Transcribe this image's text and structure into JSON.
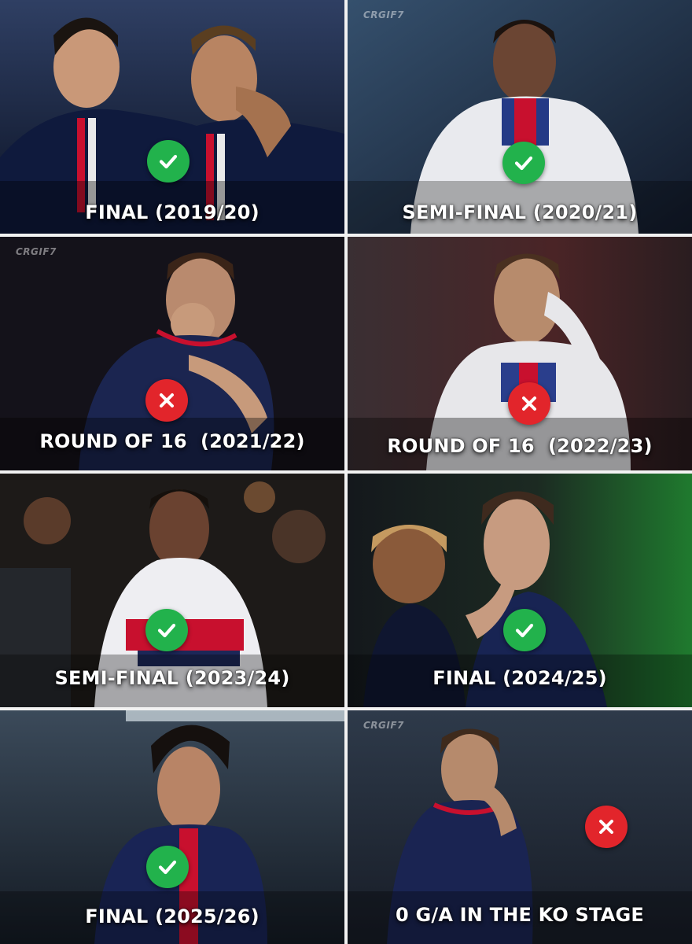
{
  "panels": [
    {
      "caption": "FINAL (2019/20)",
      "result": "check",
      "watermark": ""
    },
    {
      "caption": "SEMI-FINAL (2020/21)",
      "result": "check",
      "watermark": "CRGIF7"
    },
    {
      "caption": "ROUND OF 16  (2021/22)",
      "result": "cross",
      "watermark": "CRGIF7"
    },
    {
      "caption": "ROUND OF 16  (2022/23)",
      "result": "cross",
      "watermark": ""
    },
    {
      "caption": "SEMI-FINAL (2023/24)",
      "result": "check",
      "watermark": ""
    },
    {
      "caption": "FINAL (2024/25)",
      "result": "check",
      "watermark": ""
    },
    {
      "caption": "FINAL (2025/26)",
      "result": "check",
      "watermark": ""
    },
    {
      "caption": "0 G/A IN THE KO STAGE",
      "result": "cross",
      "watermark": "CRGIF7"
    }
  ],
  "colors": {
    "check": "#22b24c",
    "cross": "#e2252b",
    "caption_text": "#ffffff",
    "divider": "#f2f2f2"
  },
  "icons": {
    "check": "check-circle-icon",
    "cross": "cross-circle-icon"
  }
}
